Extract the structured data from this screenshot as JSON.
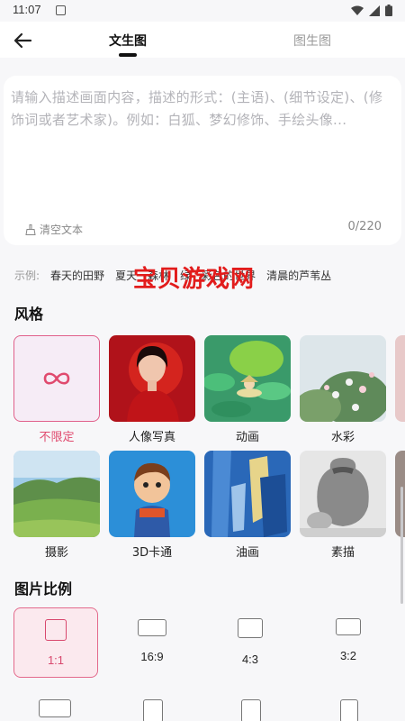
{
  "status": {
    "time": "11:07"
  },
  "header": {
    "back_icon": "arrow-left-icon",
    "tabs": [
      {
        "label": "文生图",
        "active": true
      },
      {
        "label": "图生图",
        "active": false
      }
    ]
  },
  "prompt": {
    "placeholder": "请输入描述画面内容，描述的形式：(主语)、(细节设定)、(修饰词或者艺术家)。例如：白狐、梦幻修饰、手绘头像...",
    "clear_label": "清空文本",
    "counter": "0/220"
  },
  "examples": {
    "label": "示例:",
    "items": [
      "春天的田野",
      "夏天",
      "森林",
      "绿",
      "彩色的世界",
      "清晨的芦苇丛"
    ]
  },
  "watermark": "宝贝游戏网",
  "styles": {
    "title": "风格",
    "items": [
      {
        "label": "不限定",
        "selected": true,
        "icon": "infinity-icon"
      },
      {
        "label": "人像写真"
      },
      {
        "label": "动画"
      },
      {
        "label": "水彩"
      },
      {
        "label": "摄影"
      },
      {
        "label": "3D卡通"
      },
      {
        "label": "油画"
      },
      {
        "label": "素描"
      }
    ]
  },
  "ratios": {
    "title": "图片比例",
    "items": [
      {
        "label": "1:1",
        "selected": true
      },
      {
        "label": "16:9"
      },
      {
        "label": "4:3"
      },
      {
        "label": "3:2"
      }
    ]
  },
  "colors": {
    "accent": "#e04a6e",
    "accent_bg": "#fbe9ee"
  }
}
